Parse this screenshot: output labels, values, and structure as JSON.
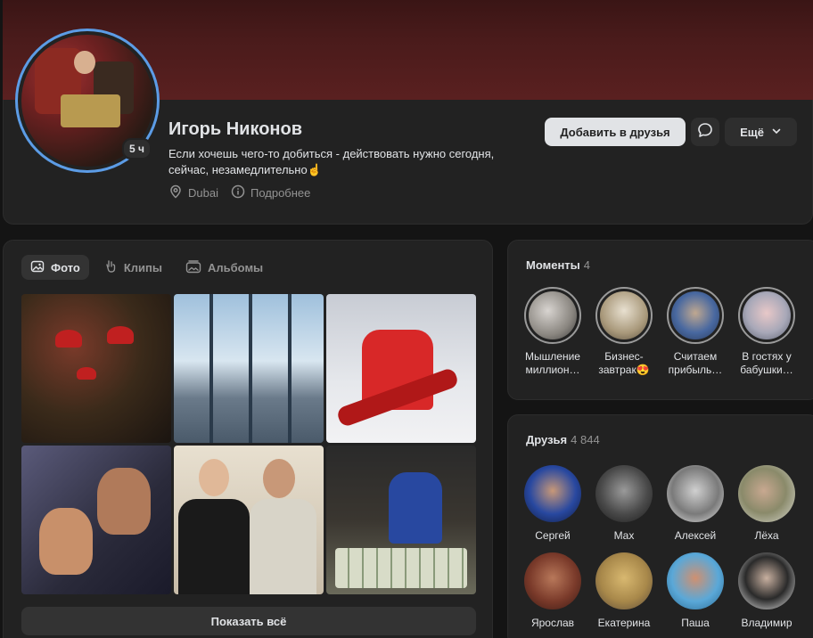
{
  "profile": {
    "name": "Игорь Никонов",
    "status": "Если хочешь чего-то добиться - действовать нужно сегодня, сейчас, незамедлительно☝️",
    "story_time": "5 ч",
    "location": "Dubai",
    "details": "Подробнее"
  },
  "actions": {
    "add_friend": "Добавить в друзья",
    "more": "Ещё"
  },
  "photos": {
    "tabs": [
      {
        "label": "Фото",
        "active": true
      },
      {
        "label": "Клипы",
        "active": false
      },
      {
        "label": "Альбомы",
        "active": false
      }
    ],
    "show_all": "Показать всё"
  },
  "moments": {
    "title": "Моменты",
    "count": "4",
    "items": [
      {
        "label": "Мышление миллион…"
      },
      {
        "label": "Бизнес-завтрак😍"
      },
      {
        "label": "Считаем прибыль…"
      },
      {
        "label": "В гостях у бабушки…"
      }
    ]
  },
  "friends": {
    "title": "Друзья",
    "count": "4 844",
    "items": [
      {
        "name": "Сергей"
      },
      {
        "name": "Max"
      },
      {
        "name": "Алексей"
      },
      {
        "name": "Лёха"
      },
      {
        "name": "Ярослав"
      },
      {
        "name": "Екатерина"
      },
      {
        "name": "Паша"
      },
      {
        "name": "Владимир"
      }
    ]
  },
  "colors": {
    "accent_ring": "#5c9ce6",
    "card_bg": "#222222",
    "page_bg": "#141414"
  }
}
